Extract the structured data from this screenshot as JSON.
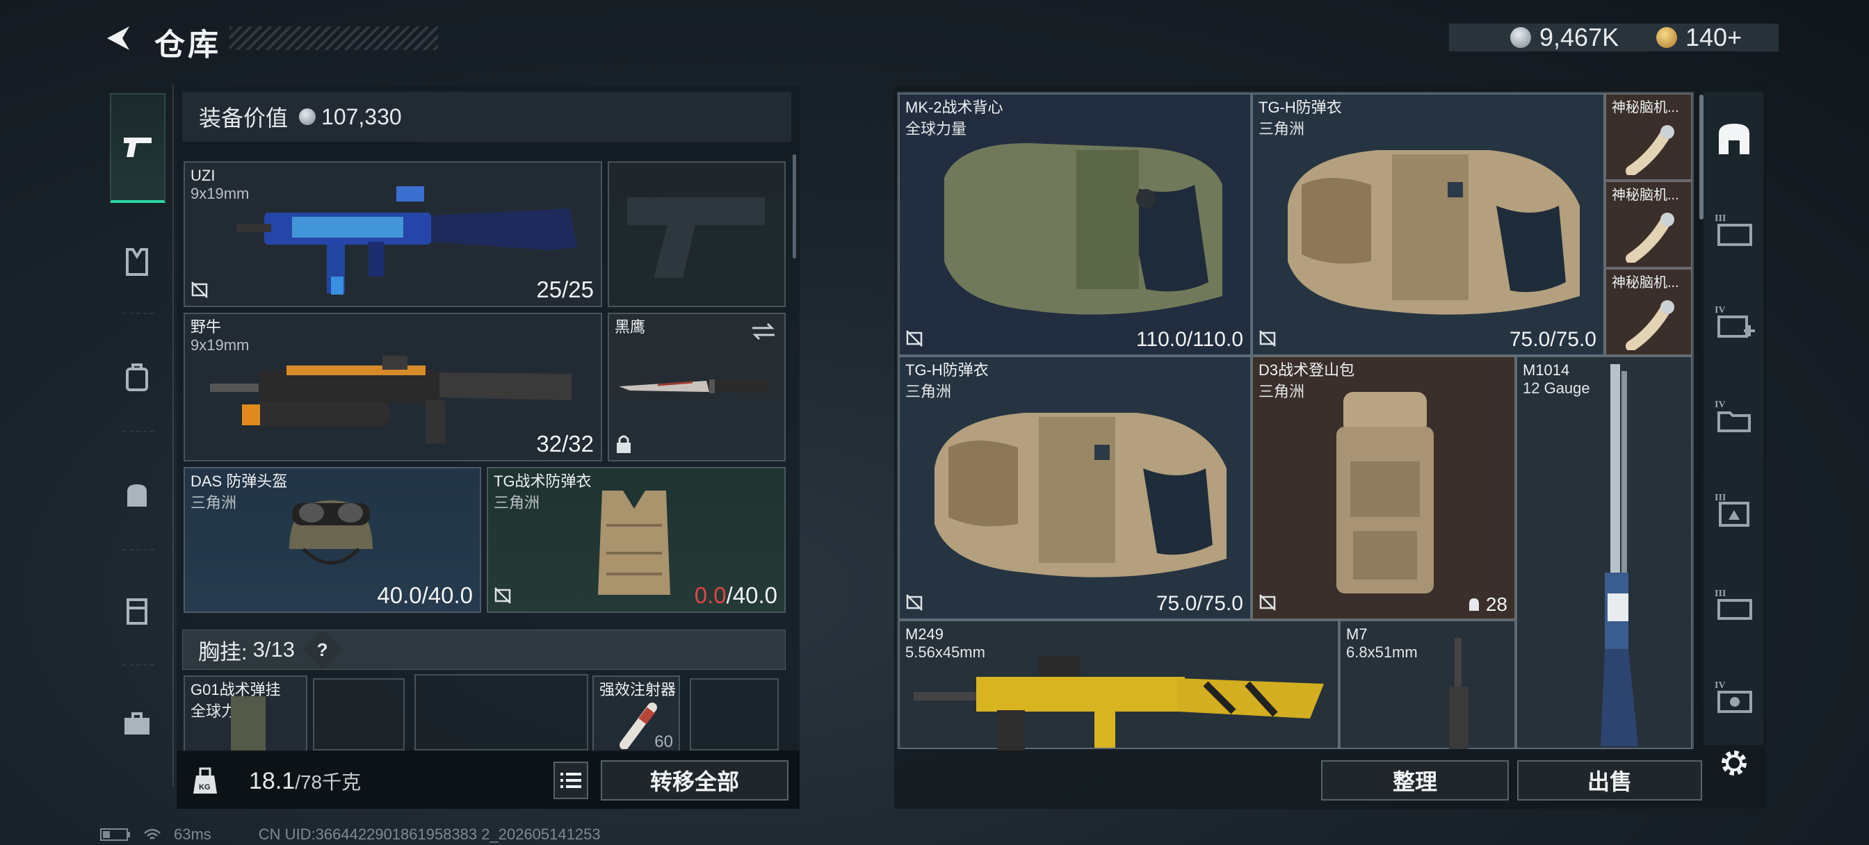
{
  "header": {
    "title": "仓库",
    "currency": {
      "silver": "9,467K",
      "gold": "140+"
    }
  },
  "nav": [
    "pistol-icon",
    "armor-icon",
    "backpack-icon",
    "bag-icon",
    "case-icon",
    "toolbox-icon"
  ],
  "loadout": {
    "value_label": "装备价值",
    "value": "107,330",
    "primary": {
      "name": "UZI",
      "ammo": "9x19mm",
      "count": "25/25"
    },
    "secondary": {
      "name": "野牛",
      "ammo": "9x19mm",
      "count": "32/32"
    },
    "melee": {
      "name": "黑鹰"
    },
    "helmet": {
      "name": "DAS 防弹头盔",
      "brand": "三角洲",
      "durability": "40.0/40.0"
    },
    "armor": {
      "name": "TG战术防弹衣",
      "brand": "三角洲",
      "dur_current": "0.0",
      "dur_max": "/40.0"
    },
    "rig": {
      "label": "胸挂:",
      "current": "3",
      "max": "/13",
      "help": "?"
    },
    "rig_items": [
      {
        "name": "G01战术弹挂",
        "brand": "全球力量"
      },
      {
        "name": "强效注射器",
        "count": "60"
      }
    ],
    "weight": {
      "current": "18.1",
      "max": "/78千克"
    },
    "transfer_all": "转移全部"
  },
  "stash": {
    "items": [
      {
        "name": "MK-2战术背心",
        "brand": "全球力量",
        "value": "110.0/110.0"
      },
      {
        "name": "TG-H防弹衣",
        "brand": "三角洲",
        "value": "75.0/75.0"
      },
      {
        "name": "神秘脑机...",
        "brand": "",
        "value": ""
      },
      {
        "name": "神秘脑机...",
        "brand": "",
        "value": ""
      },
      {
        "name": "神秘脑机...",
        "brand": "",
        "value": ""
      },
      {
        "name": "TG-H防弹衣",
        "brand": "三角洲",
        "value": "75.0/75.0"
      },
      {
        "name": "D3战术登山包",
        "brand": "三角洲",
        "value": "28"
      },
      {
        "name": "M1014",
        "brand": "12 Gauge",
        "value": ""
      },
      {
        "name": "M249",
        "brand": "5.56x45mm",
        "value": ""
      },
      {
        "name": "M7",
        "brand": "6.8x51mm",
        "value": ""
      }
    ],
    "sort": "整理",
    "sell": "出售"
  },
  "right_tabs": [
    "stash-main-icon",
    "III",
    "IV",
    "IV",
    "III",
    "III",
    "IV",
    "settings-icon"
  ],
  "status": {
    "ping": "63ms",
    "uid": "CN UID:3664422901861958383 2_202605141253"
  }
}
